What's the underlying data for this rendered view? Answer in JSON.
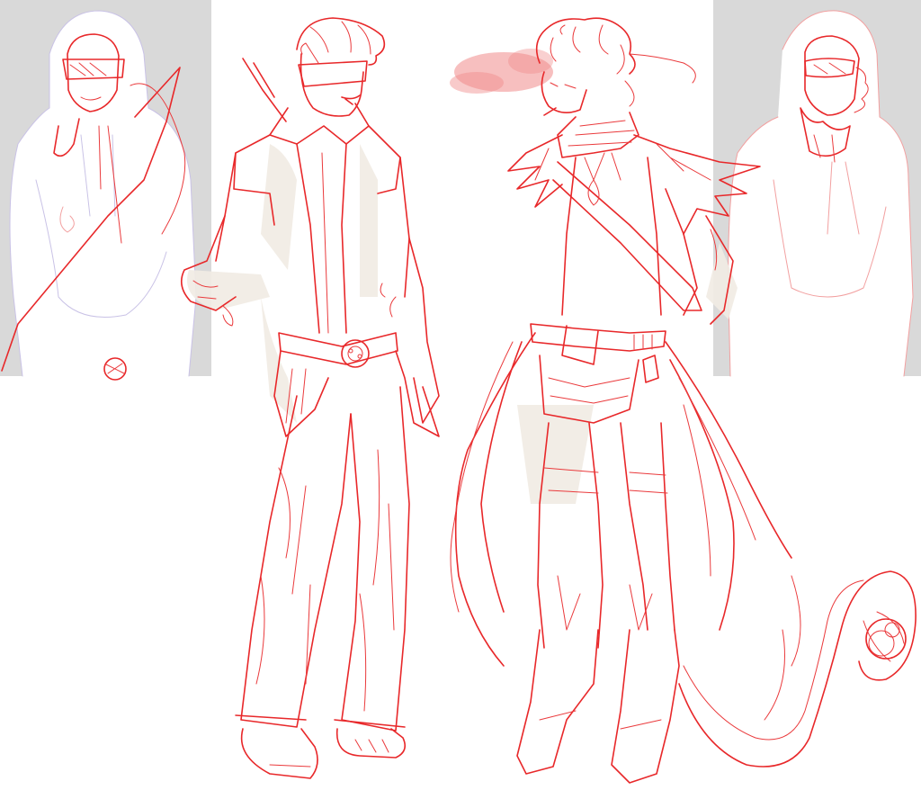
{
  "artwork": {
    "kind": "sketch",
    "colors": {
      "background": "#ffffff",
      "reference_panel": "#d9d9d9",
      "line": "#e8282a",
      "skin_tone": "#f1ebe3",
      "smoke": "#f08a8a"
    },
    "panels": [
      "reference-left",
      "reference-right"
    ],
    "figures": [
      "figure-left-goggles",
      "figure-right-coat-tail"
    ]
  }
}
